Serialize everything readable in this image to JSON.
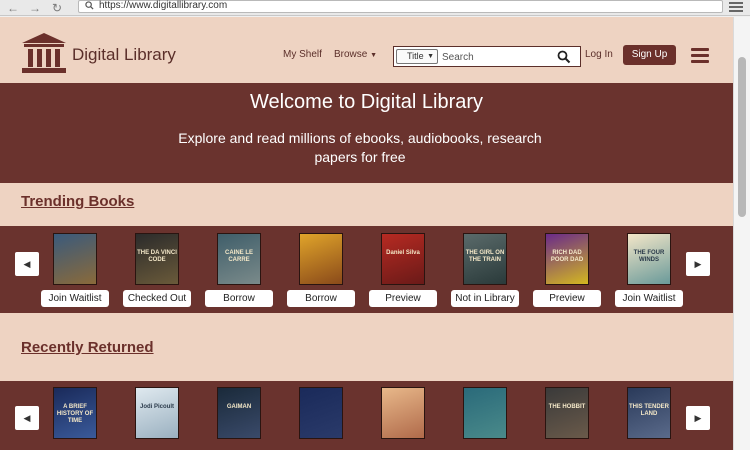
{
  "browser": {
    "url": "https://www.digitallibrary.com"
  },
  "header": {
    "site_title": "Digital Library",
    "nav_my_shelf": "My Shelf",
    "nav_browse": "Browse",
    "search_select": "Title",
    "search_placeholder": "Search",
    "login": "Log In",
    "signup": "Sign Up"
  },
  "hero": {
    "title": "Welcome to Digital Library",
    "subtitle": "Explore and read millions of ebooks, audiobooks, research papers for free"
  },
  "trending": {
    "title": "Trending Books",
    "books": [
      {
        "action": "Join Waitlist",
        "colors": [
          "#3a5a7c",
          "#8a6a3a"
        ],
        "cover_text": ""
      },
      {
        "action": "Checked Out",
        "colors": [
          "#2b2b2b",
          "#6a5a3a"
        ],
        "cover_text": "THE DA VINCI CODE"
      },
      {
        "action": "Borrow",
        "colors": [
          "#3f5e6a",
          "#7a8a8a"
        ],
        "cover_text": "CAINE  LE CARRE"
      },
      {
        "action": "Borrow",
        "colors": [
          "#e0a42a",
          "#8a4a1a"
        ],
        "cover_text": ""
      },
      {
        "action": "Preview",
        "colors": [
          "#b62a22",
          "#6a1a18"
        ],
        "cover_text": "Daniel Silva"
      },
      {
        "action": "Not in Library",
        "colors": [
          "#5a6a6a",
          "#2a3a3a"
        ],
        "cover_text": "THE GIRL ON THE TRAIN"
      },
      {
        "action": "Preview",
        "colors": [
          "#6a2a8a",
          "#d4b820"
        ],
        "cover_text": "RICH DAD POOR DAD"
      },
      {
        "action": "Join Waitlist",
        "colors": [
          "#f3e6c8",
          "#6a9a9a"
        ],
        "cover_text": "THE FOUR WINDS"
      }
    ]
  },
  "returned": {
    "title": "Recently Returned",
    "books": [
      {
        "colors": [
          "#1a2a5a",
          "#3a5a9a"
        ],
        "cover_text": "A BRIEF HISTORY OF TIME"
      },
      {
        "colors": [
          "#dfe9ef",
          "#9ab0c0"
        ],
        "cover_text": "Jodi Picoult"
      },
      {
        "colors": [
          "#1a2a3a",
          "#3a4a6a"
        ],
        "cover_text": "GAIMAN"
      },
      {
        "colors": [
          "#1a2a5a",
          "#2a3a6a"
        ],
        "cover_text": ""
      },
      {
        "colors": [
          "#e8b88a",
          "#b06a4a"
        ],
        "cover_text": ""
      },
      {
        "colors": [
          "#2a6a7a",
          "#4a8a8a"
        ],
        "cover_text": ""
      },
      {
        "colors": [
          "#3a3a3a",
          "#6a5a4a"
        ],
        "cover_text": "THE HOBBIT"
      },
      {
        "colors": [
          "#2a3a5a",
          "#5a6a8a"
        ],
        "cover_text": "THIS TENDER LAND"
      }
    ]
  },
  "colors": {
    "brand": "#6b302b",
    "header_bg": "#eed3c2",
    "band_bg": "#6a332e"
  }
}
